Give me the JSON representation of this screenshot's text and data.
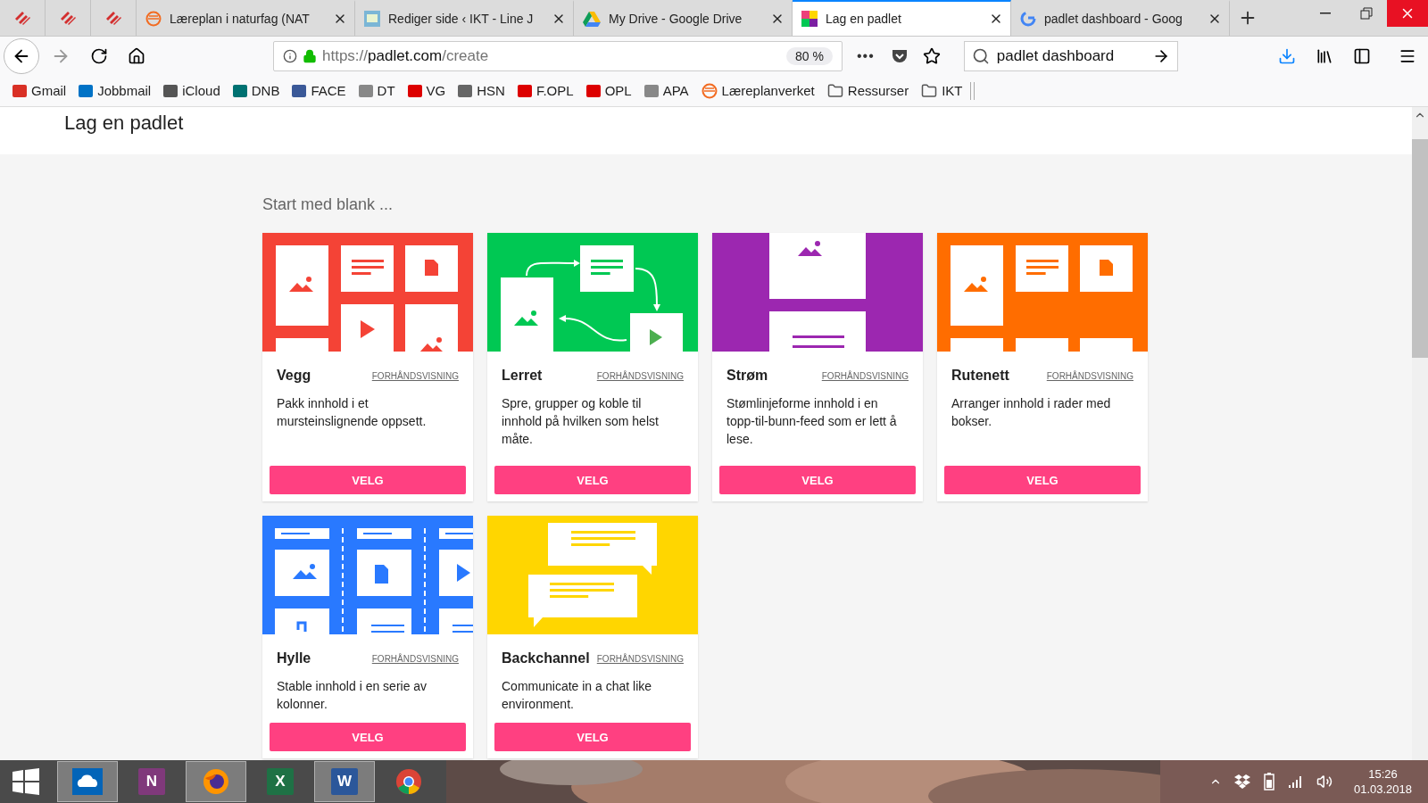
{
  "browser": {
    "pinned_tabs": [
      {
        "selected": false
      },
      {
        "selected": false
      },
      {
        "selected": false
      }
    ],
    "tabs": [
      {
        "kind": "orange",
        "title": "Læreplan i naturfag (NAT",
        "selected": false
      },
      {
        "kind": "site",
        "title": "Rediger side ‹ IKT - Line J",
        "selected": false
      },
      {
        "kind": "drive",
        "title": "My Drive - Google Drive",
        "selected": false
      },
      {
        "kind": "padlet",
        "title": "Lag en padlet",
        "selected": true
      },
      {
        "kind": "google",
        "title": "padlet dashboard - Goog",
        "selected": false
      }
    ],
    "url": {
      "scheme": "https://",
      "host": "padlet.com",
      "path": "/create"
    },
    "zoom": "80 %",
    "more": "•••",
    "search": {
      "value": "padlet dashboard"
    },
    "bookmarks": [
      {
        "kind": "gmail",
        "label": "Gmail"
      },
      {
        "kind": "outlook",
        "label": "Jobbmail"
      },
      {
        "kind": "apple",
        "label": "iCloud"
      },
      {
        "kind": "dnb",
        "label": "DNB"
      },
      {
        "kind": "facebook",
        "label": "FACE"
      },
      {
        "kind": "dt",
        "label": "DT"
      },
      {
        "kind": "vg",
        "label": "VG"
      },
      {
        "kind": "hsn",
        "label": "HSN"
      },
      {
        "kind": "opl",
        "label": "F.OPL"
      },
      {
        "kind": "opl",
        "label": "OPL"
      },
      {
        "kind": "apa",
        "label": "APA"
      },
      {
        "kind": "orange",
        "label": "Læreplanverket"
      },
      {
        "kind": "folder",
        "label": "Ressurser"
      },
      {
        "kind": "folder",
        "label": "IKT"
      }
    ]
  },
  "page": {
    "title": "Lag en padlet",
    "section": "Start med blank ...",
    "cards": [
      {
        "kind": "wall",
        "color": "#f44336",
        "title": "Vegg",
        "preview": "FORHÅNDSVISNING",
        "description": "Pakk innhold i et mursteinslignende oppsett.",
        "button": "VELG"
      },
      {
        "kind": "canvas",
        "color": "#00c853",
        "title": "Lerret",
        "preview": "FORHÅNDSVISNING",
        "description": "Spre, grupper og koble til innhold på hvilken som helst måte.",
        "button": "VELG"
      },
      {
        "kind": "stream",
        "color": "#9c27b0",
        "title": "Strøm",
        "preview": "FORHÅNDSVISNING",
        "description": "Stømlinjeforme innhold i en topp-til-bunn-feed som er lett å lese.",
        "button": "VELG"
      },
      {
        "kind": "grid",
        "color": "#ff6d00",
        "title": "Rutenett",
        "preview": "FORHÅNDSVISNING",
        "description": "Arranger innhold i rader med bokser.",
        "button": "VELG"
      },
      {
        "kind": "shelf",
        "color": "#2979ff",
        "title": "Hylle",
        "preview": "FORHÅNDSVISNING",
        "description": "Stable innhold i en serie av kolonner.",
        "button": "VELG"
      },
      {
        "kind": "backchannel",
        "color": "#ffd600",
        "title": "Backchannel",
        "preview": "FORHÅNDSVISNING",
        "description": "Communicate in a chat like environment.",
        "button": "VELG"
      }
    ]
  },
  "taskbar": {
    "apps": [
      {
        "kind": "onedrive",
        "running": true
      },
      {
        "kind": "onenote",
        "glyph": "N",
        "running": false
      },
      {
        "kind": "firefox",
        "running": true
      },
      {
        "kind": "excel",
        "glyph": "X",
        "running": false
      },
      {
        "kind": "word",
        "glyph": "W",
        "running": true
      },
      {
        "kind": "chrome",
        "running": false
      }
    ],
    "time": "15:26",
    "date": "01.03.2018"
  }
}
